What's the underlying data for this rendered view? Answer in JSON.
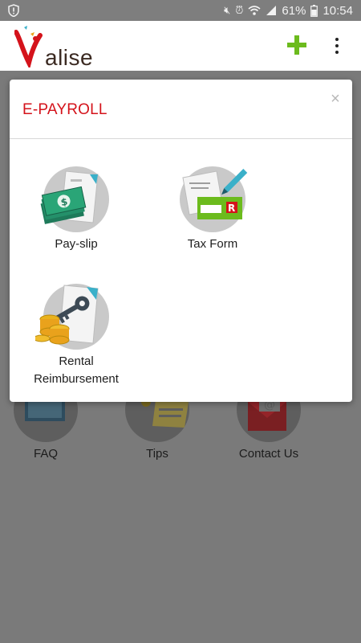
{
  "status_bar": {
    "battery": "61%",
    "time": "10:54"
  },
  "app_bar": {
    "logo_text": "alise",
    "logo_letter": "V"
  },
  "background_items": [
    {
      "label": "FAQ"
    },
    {
      "label": "Tips"
    },
    {
      "label": "Contact Us"
    }
  ],
  "modal": {
    "title": "E-PAYROLL",
    "close": "×",
    "tiles": [
      {
        "label": "Pay-slip",
        "icon": "payslip-money-icon"
      },
      {
        "label": "Tax Form",
        "icon": "tax-form-icon"
      },
      {
        "label": "Rental Reimbursement",
        "icon": "rental-key-coins-icon"
      }
    ]
  },
  "colors": {
    "accent_red": "#d4131b",
    "plus_green": "#6cbb1d",
    "overlay_gray": "#7a7a7a"
  }
}
